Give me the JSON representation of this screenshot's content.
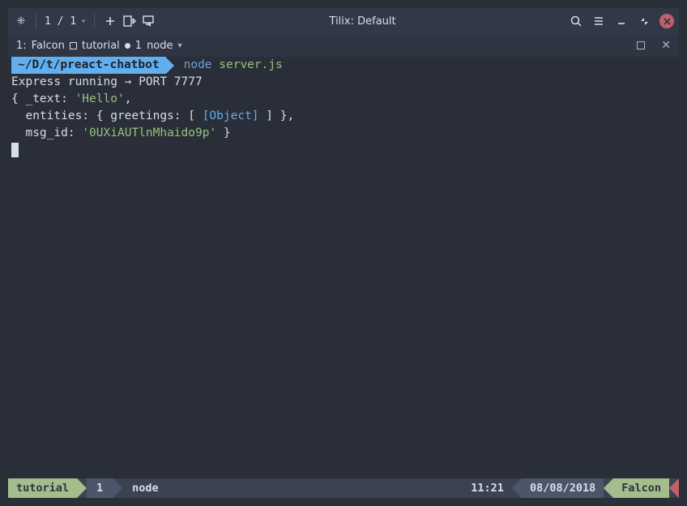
{
  "titlebar": {
    "pages": "1 / 1",
    "title": "Tilix: Default"
  },
  "tabbar": {
    "index": "1:",
    "name1": "Falcon",
    "name2": "tutorial",
    "proc_num": "1",
    "proc_name": "node"
  },
  "prompt": {
    "path": "~/D/t/preact-chatbot",
    "cmd_bin": "node",
    "cmd_arg": "server.js"
  },
  "output": {
    "l1": "Express running → PORT 7777",
    "l2a": "{ _text: ",
    "l2b": "'Hello'",
    "l2c": ",",
    "l3a": "  entities: { greetings: [ ",
    "l3b": "[Object]",
    "l3c": " ] },",
    "l4a": "  msg_id: ",
    "l4b": "'0UXiAUTlnMhaido9p'",
    "l4c": " }"
  },
  "statusbar": {
    "dir": "tutorial",
    "num": "1",
    "proc": "node",
    "time": "11:21",
    "date": "08/08/2018",
    "host": "Falcon"
  }
}
